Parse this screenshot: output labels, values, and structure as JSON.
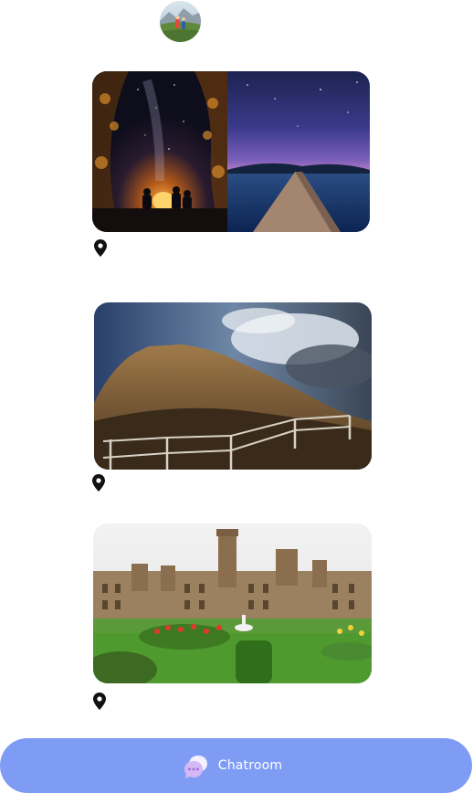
{
  "profile": {
    "avatar_icon": "avatar-hikers-photo"
  },
  "feed": {
    "posts": [
      {
        "image": "campfire-night-sky-and-pier-photo",
        "location": ""
      },
      {
        "image": "hill-fort-with-fence-photo",
        "location": ""
      },
      {
        "image": "palace-with-garden-photo",
        "location": ""
      }
    ],
    "pin_icon": "map-pin-icon"
  },
  "chatroom": {
    "label": "Chatroom",
    "icon": "chat-bubbles-icon",
    "bar_color": "#7f9cf5"
  }
}
